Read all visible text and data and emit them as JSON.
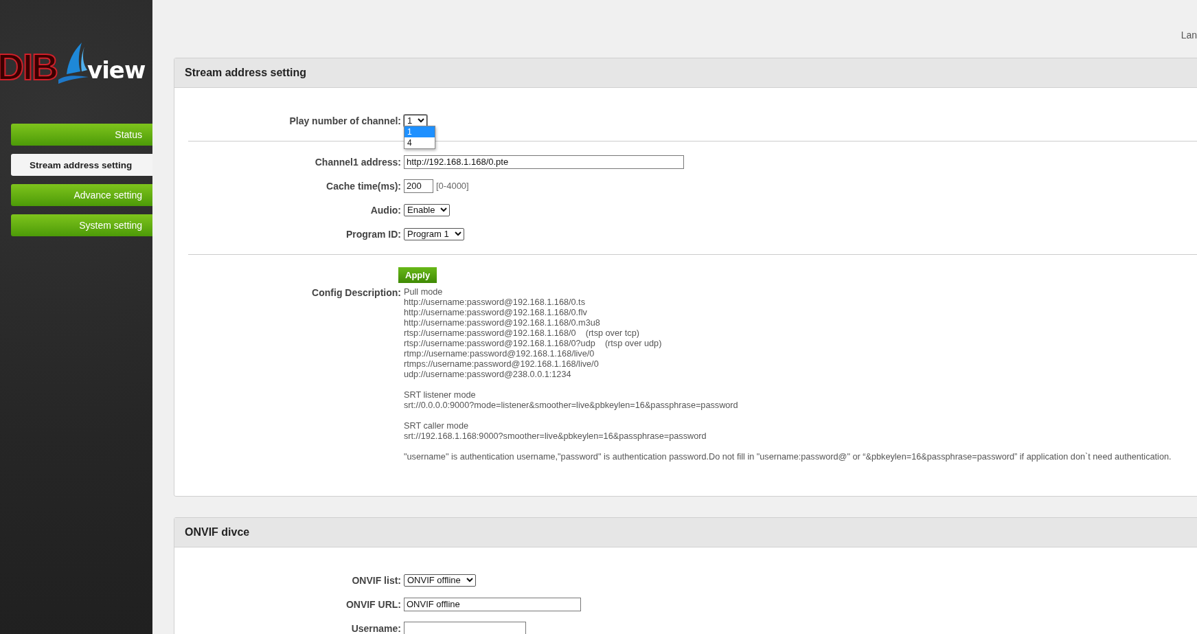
{
  "sidebar": {
    "logo": {
      "brand": "DIB",
      "product": "view"
    },
    "nav": [
      {
        "label": "Status",
        "selected": false
      },
      {
        "label": "Stream address setting",
        "selected": true
      },
      {
        "label": "Advance setting",
        "selected": false
      },
      {
        "label": "System setting",
        "selected": false
      }
    ]
  },
  "top_bar": {
    "language_label": "Lan"
  },
  "panels": [
    {
      "title": "Stream address setting",
      "rows": [
        {
          "kind": "select",
          "label": "Play number of channel:",
          "value": "1",
          "expanded": true,
          "options": [
            {
              "label": "1",
              "selected": true
            },
            {
              "label": "4",
              "selected": false
            }
          ]
        },
        {
          "kind": "divider"
        },
        {
          "kind": "input",
          "label": "Channel1 address:",
          "value": "http://192.168.1.168/0.pte"
        },
        {
          "kind": "input",
          "label": "Cache time(ms):",
          "value": "200",
          "hint": "[0-4000]"
        },
        {
          "kind": "select",
          "label": "Audio:",
          "value": "Enable"
        },
        {
          "kind": "select",
          "label": "Program ID:",
          "value": "Program 1"
        },
        {
          "kind": "divider"
        },
        {
          "kind": "button",
          "label": "Apply"
        },
        {
          "kind": "description",
          "label": "Config Description:",
          "paragraphs": [
            [
              "Pull mode",
              "http://username:password@192.168.1.168/0.ts",
              "http://username:password@192.168.1.168/0.flv",
              "http://username:password@192.168.1.168/0.m3u8",
              "rtsp://username:password@192.168.1.168/0    (rtsp over tcp)",
              "rtsp://username:password@192.168.1.168/0?udp    (rtsp over udp)",
              "rtmp://username:password@192.168.1.168/live/0",
              "rtmps://username:password@192.168.1.168/live/0",
              "udp://username:password@238.0.0.1:1234"
            ],
            [
              "SRT listener mode",
              "srt://0.0.0.0:9000?mode=listener&smoother=live&pbkeylen=16&passphrase=password"
            ],
            [
              "SRT caller mode",
              "srt://192.168.1.168:9000?smoother=live&pbkeylen=16&passphrase=password"
            ],
            [
              "\"username\" is authentication username,\"password\" is authentication password.Do not fill in \"username:password@\" or “&pbkeylen=16&passphrase=password” if application don`t need authentication."
            ]
          ]
        }
      ]
    },
    {
      "title": "ONVIF divce",
      "rows": [
        {
          "kind": "select",
          "label": "ONVIF list:",
          "value": "ONVIF offline"
        },
        {
          "kind": "input",
          "label": "ONVIF URL:",
          "value": "ONVIF offline"
        },
        {
          "kind": "input",
          "label": "Username:",
          "value": ""
        }
      ]
    }
  ]
}
